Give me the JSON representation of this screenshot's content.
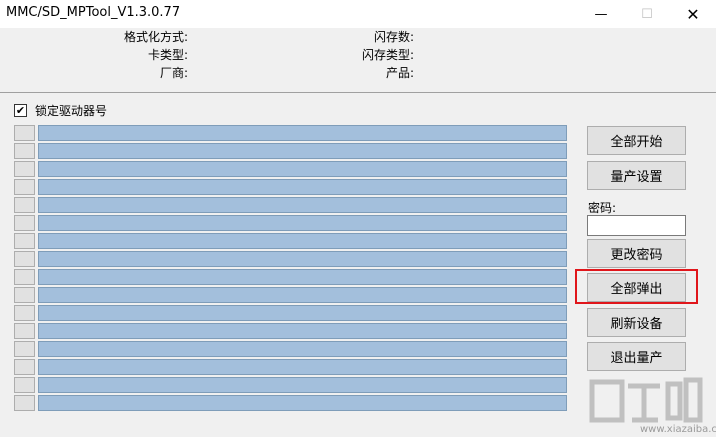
{
  "window": {
    "title": "MMC/SD_MPTool_V1.3.0.77",
    "minimize": "—",
    "maximize": "☐",
    "close": "✕"
  },
  "info": {
    "format_label": "格式化方式:",
    "format_value": "",
    "card_type_label": "卡类型:",
    "card_type_value": "",
    "vendor_label": "厂商:",
    "vendor_value": "",
    "flash_count_label": "闪存数:",
    "flash_count_value": "",
    "flash_type_label": "闪存类型:",
    "flash_type_value": "",
    "product_label": "产品:",
    "product_value": ""
  },
  "lock_drive": {
    "label": "锁定驱动器号",
    "checked": true,
    "check_glyph": "✔"
  },
  "slots": {
    "count": 16
  },
  "side": {
    "start_all": "全部开始",
    "settings": "量产设置",
    "password_label": "密码:",
    "password_value": "",
    "change_password": "更改密码",
    "eject_all": "全部弹出",
    "refresh": "刷新设备",
    "exit": "退出量产"
  },
  "colors": {
    "bar": "#a3bfdc",
    "highlight": "#e0161b"
  },
  "watermark": {
    "text": "下载吧",
    "sub": "www.xiazaiba.com"
  }
}
